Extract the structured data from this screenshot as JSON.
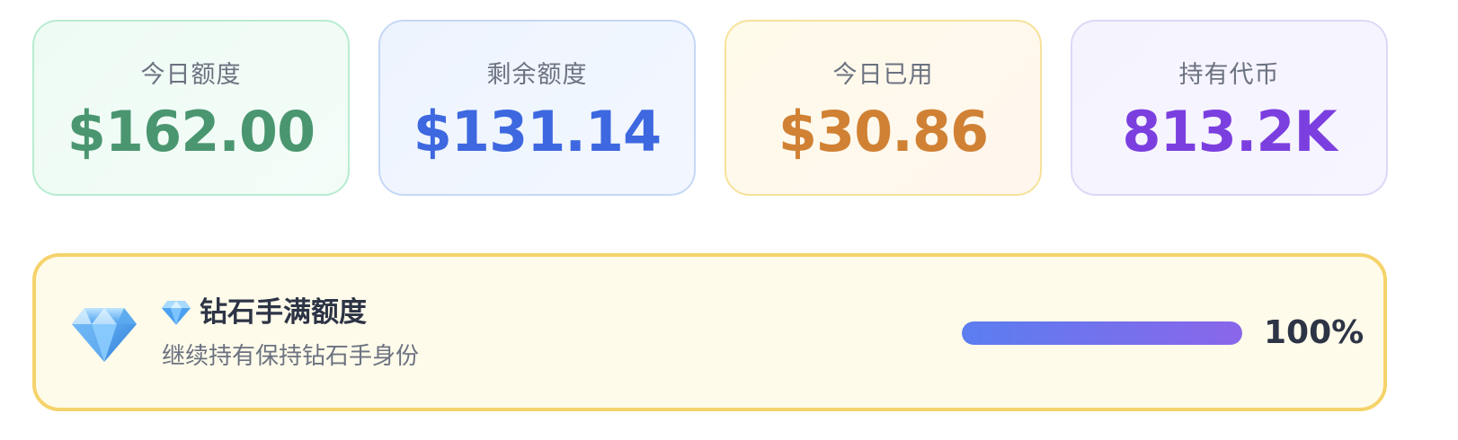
{
  "stats": [
    {
      "label": "今日额度",
      "value": "$162.00",
      "color": "#4a9670"
    },
    {
      "label": "剩余额度",
      "value": "$131.14",
      "color": "#3d68e0"
    },
    {
      "label": "今日已用",
      "value": "$30.86",
      "color": "#d08134"
    },
    {
      "label": "持有代币",
      "value": "813.2K",
      "color": "#7b3fe0"
    }
  ],
  "banner": {
    "icon": "diamond-icon",
    "title": "钻石手满额度",
    "subtitle": "继续持有保持钻石手身份",
    "progress_percent": 100,
    "progress_label": "100%",
    "border_color": "#f5d36b",
    "progress_gradient": [
      "#5b7ef0",
      "#8a66ea"
    ]
  }
}
